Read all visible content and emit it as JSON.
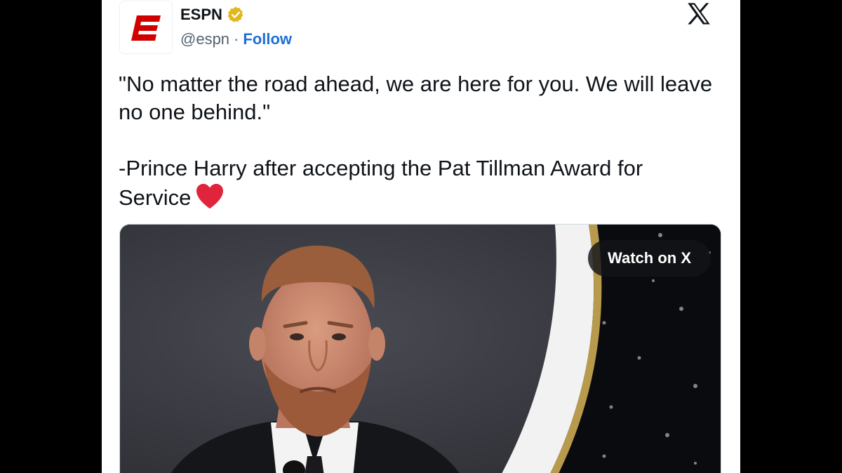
{
  "account": {
    "display_name": "ESPN",
    "handle": "@espn",
    "separator": "·",
    "follow_label": "Follow",
    "verified": true,
    "verified_color": "#e2b719",
    "brand_color": "#d00000"
  },
  "tweet": {
    "text_line_1": "\"No matter the road ahead, we are here for you. We will leave no one behind.\"",
    "text_line_2": "-Prince Harry after accepting the Pat Tillman Award for Service",
    "emoji": "heart-icon"
  },
  "media": {
    "watch_label": "Watch on X"
  },
  "colors": {
    "follow_link": "#1d6fd8",
    "heart": "#e0243c",
    "text": "#0f1419",
    "secondary_text": "#536471"
  }
}
